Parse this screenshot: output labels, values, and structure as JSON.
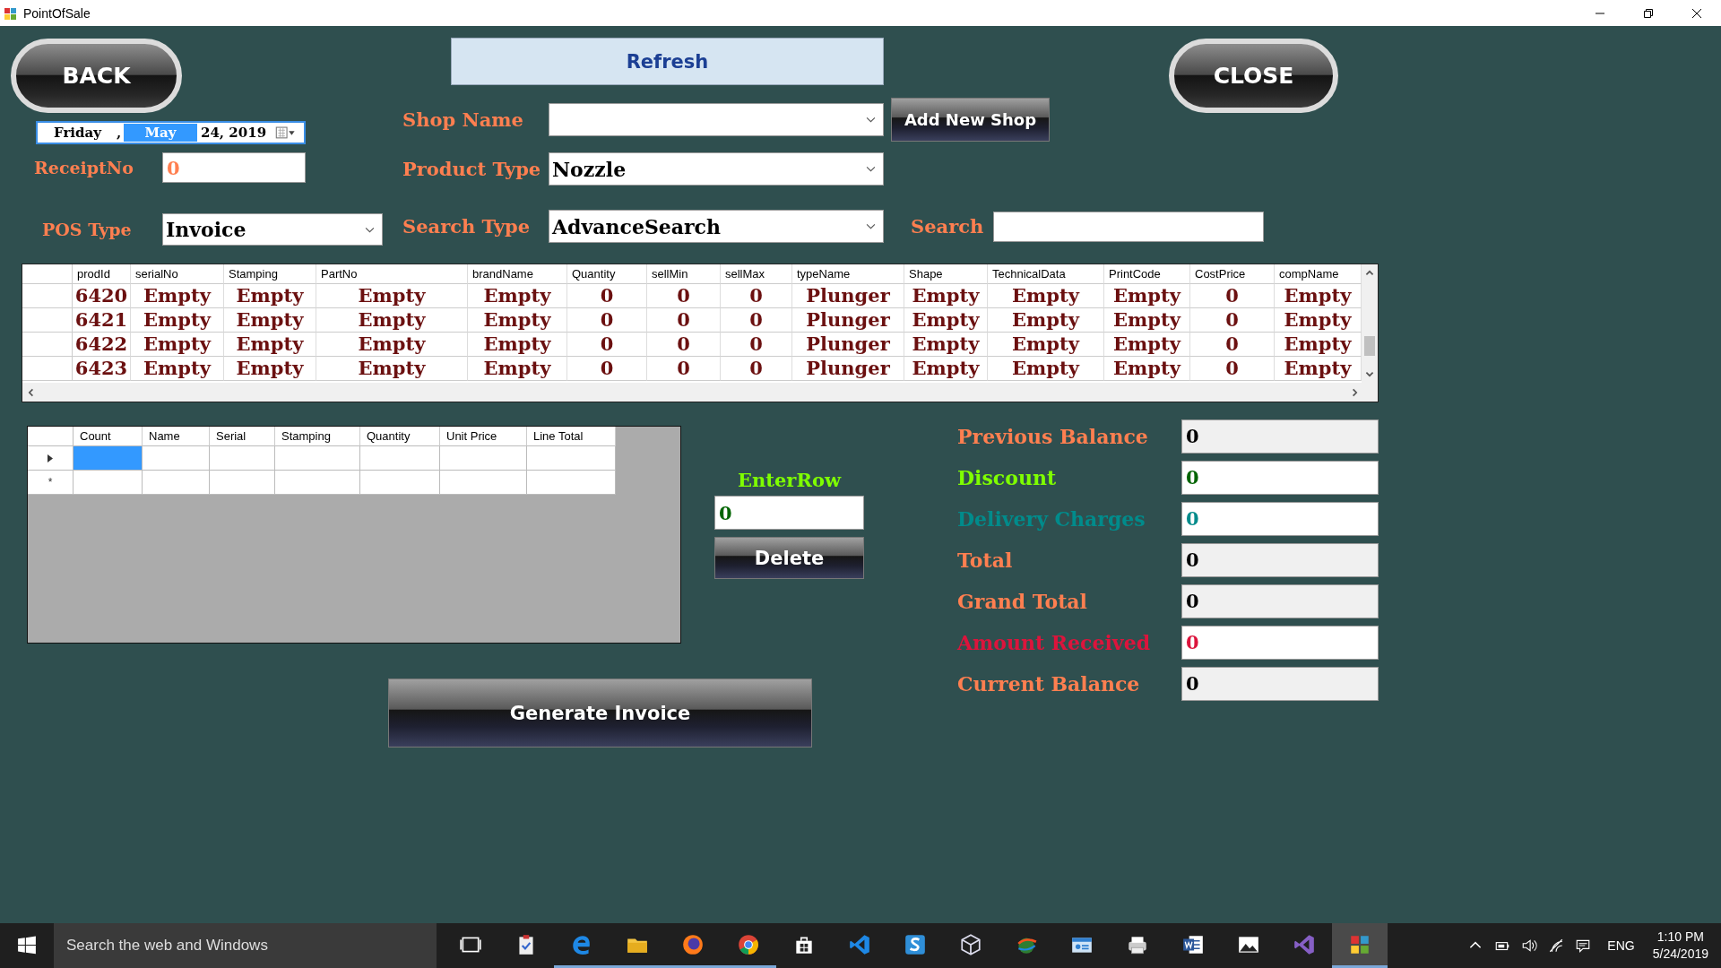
{
  "window": {
    "title": "PointOfSale"
  },
  "buttons": {
    "back": "BACK",
    "refresh": "Refresh",
    "close": "CLOSE",
    "add_shop": "Add New Shop",
    "delete": "Delete",
    "generate": "Generate Invoice"
  },
  "date_picker": {
    "parts": [
      {
        "text": "Friday",
        "selected": false
      },
      {
        "text": ",",
        "selected": false
      },
      {
        "text": "May",
        "selected": true
      },
      {
        "text": "24, 2019",
        "selected": false
      }
    ]
  },
  "form": {
    "receipt_no": {
      "label": "ReceiptNo",
      "value": "0"
    },
    "pos_type": {
      "label": "POS Type",
      "value": "Invoice"
    },
    "shop_name": {
      "label": "Shop Name"
    },
    "product_type": {
      "label": "Product Type",
      "value": "Nozzle"
    },
    "search_type": {
      "label": "Search Type",
      "value": "AdvanceSearch"
    },
    "search": {
      "label": "Search"
    }
  },
  "products_table": {
    "columns": [
      "prodId",
      "serialNo",
      "Stamping",
      "PartNo",
      "brandName",
      "Quantity",
      "sellMin",
      "sellMax",
      "typeName",
      "Shape",
      "TechnicalData",
      "PrintCode",
      "CostPrice",
      "compName"
    ],
    "rows": [
      [
        "6420",
        "Empty",
        "Empty",
        "Empty",
        "Empty",
        "0",
        "0",
        "0",
        "Plunger",
        "Empty",
        "Empty",
        "Empty",
        "0",
        "Empty"
      ],
      [
        "6421",
        "Empty",
        "Empty",
        "Empty",
        "Empty",
        "0",
        "0",
        "0",
        "Plunger",
        "Empty",
        "Empty",
        "Empty",
        "0",
        "Empty"
      ],
      [
        "6422",
        "Empty",
        "Empty",
        "Empty",
        "Empty",
        "0",
        "0",
        "0",
        "Plunger",
        "Empty",
        "Empty",
        "Empty",
        "0",
        "Empty"
      ],
      [
        "6423",
        "Empty",
        "Empty",
        "Empty",
        "Empty",
        "0",
        "0",
        "0",
        "Plunger",
        "Empty",
        "Empty",
        "Empty",
        "0",
        "Empty"
      ]
    ]
  },
  "order_grid": {
    "columns": [
      "Count",
      "Name",
      "Serial",
      "Stamping",
      "Quantity",
      "Unit Price",
      "Line Total"
    ],
    "rows": [
      {
        "kind": "current",
        "cells": [
          {
            "selected": true
          },
          {
            "selected": false
          },
          {
            "selected": false
          },
          {
            "selected": false
          },
          {
            "selected": false
          },
          {
            "selected": false
          },
          {
            "selected": false
          }
        ]
      },
      {
        "kind": "new",
        "marker": "*",
        "cells": [
          {
            "selected": false
          },
          {
            "selected": false
          },
          {
            "selected": false
          },
          {
            "selected": false
          },
          {
            "selected": false
          },
          {
            "selected": false
          },
          {
            "selected": false
          }
        ]
      }
    ]
  },
  "enter_row": {
    "label": "EnterRow",
    "value": "0"
  },
  "totals": [
    {
      "label": "Previous Balance",
      "color": "#ff7f50",
      "field": {
        "value": "0",
        "color": "#000000",
        "readonly": true
      }
    },
    {
      "label": "Discount",
      "color": "#7fff00",
      "field": {
        "value": "0",
        "color": "#006400",
        "readonly": false
      }
    },
    {
      "label": "Delivery Charges",
      "color": "#008b8b",
      "field": {
        "value": "0",
        "color": "#008b8b",
        "readonly": false
      }
    },
    {
      "label": "Total",
      "color": "#ff7f50",
      "field": {
        "value": "0",
        "color": "#000000",
        "readonly": true
      }
    },
    {
      "label": "Grand Total",
      "color": "#ff7f50",
      "field": {
        "value": "0",
        "color": "#000000",
        "readonly": true
      }
    },
    {
      "label": "Amount Received",
      "color": "#dc143c",
      "field": {
        "value": "0",
        "color": "#dc143c",
        "readonly": false
      }
    },
    {
      "label": "Current Balance",
      "color": "#ff7f50",
      "field": {
        "value": "0",
        "color": "#000000",
        "readonly": true
      }
    }
  ],
  "taskbar": {
    "search_placeholder": "Search the web and Windows",
    "apps": [
      {
        "kind": "task-view",
        "selected": false,
        "running": false
      },
      {
        "kind": "clipboard",
        "selected": false,
        "running": false
      },
      {
        "kind": "edge",
        "selected": false,
        "running": true
      },
      {
        "kind": "folder",
        "selected": false,
        "running": true
      },
      {
        "kind": "firefox",
        "selected": false,
        "running": true
      },
      {
        "kind": "chrome",
        "selected": false,
        "running": true
      },
      {
        "kind": "store",
        "selected": false,
        "running": false
      },
      {
        "kind": "vscode",
        "selected": false,
        "running": false
      },
      {
        "kind": "sublime",
        "selected": false,
        "running": false
      },
      {
        "kind": "cube",
        "selected": false,
        "running": false
      },
      {
        "kind": "globe",
        "selected": false,
        "running": false
      },
      {
        "kind": "contacts",
        "selected": false,
        "running": false
      },
      {
        "kind": "printer",
        "selected": false,
        "running": false
      },
      {
        "kind": "word",
        "selected": false,
        "running": false
      },
      {
        "kind": "photos",
        "selected": false,
        "running": false
      },
      {
        "kind": "visual-studio",
        "selected": false,
        "running": false
      },
      {
        "kind": "pos",
        "selected": true,
        "running": true
      }
    ],
    "language": "ENG",
    "time": "1:10 PM",
    "date": "5/24/2019"
  }
}
